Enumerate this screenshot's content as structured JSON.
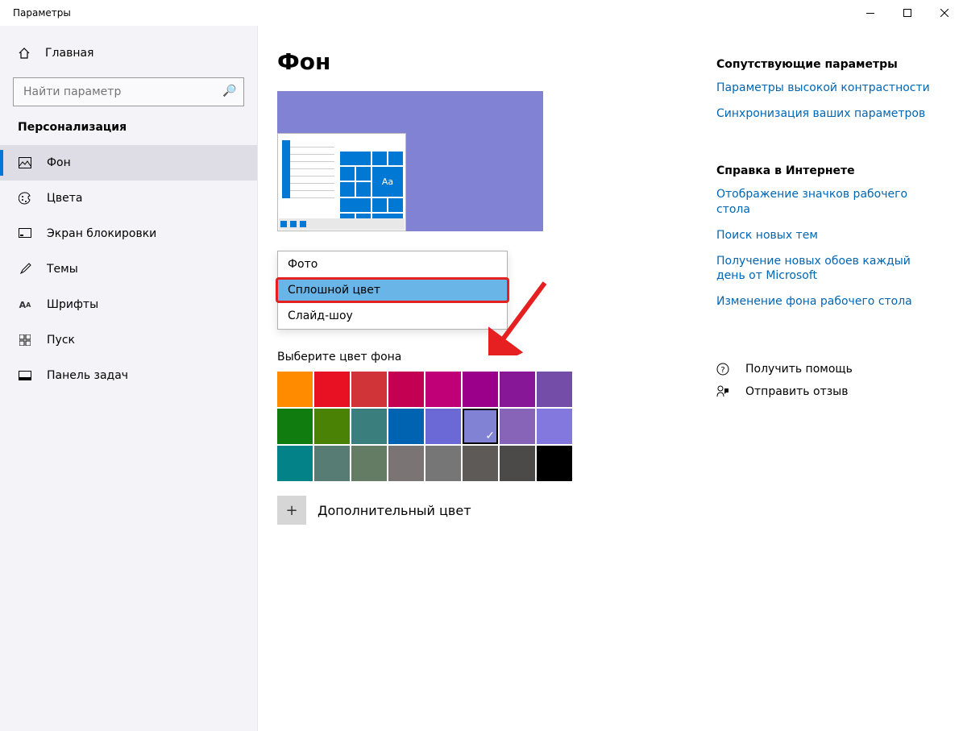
{
  "window": {
    "title": "Параметры"
  },
  "sidebar": {
    "home_label": "Главная",
    "search_placeholder": "Найти параметр",
    "section": "Персонализация",
    "items": [
      {
        "label": "Фон"
      },
      {
        "label": "Цвета"
      },
      {
        "label": "Экран блокировки"
      },
      {
        "label": "Темы"
      },
      {
        "label": "Шрифты"
      },
      {
        "label": "Пуск"
      },
      {
        "label": "Панель задач"
      }
    ]
  },
  "main": {
    "heading": "Фон",
    "preview_sample": "Aa",
    "dropdown": {
      "options": [
        {
          "label": "Фото"
        },
        {
          "label": "Сплошной цвет"
        },
        {
          "label": "Слайд-шоу"
        }
      ],
      "selected_index": 1
    },
    "swatch_label": "Выберите цвет фона",
    "swatches": [
      "#ff8c00",
      "#e81123",
      "#d13438",
      "#c30052",
      "#bf0077",
      "#9a0089",
      "#881798",
      "#744da9",
      "#107c10",
      "#498205",
      "#3a7e7e",
      "#0063b1",
      "#6b69d6",
      "#8182d4",
      "#8764b8",
      "#8378de",
      "#038387",
      "#567c73",
      "#647c64",
      "#7a7574",
      "#767676",
      "#5d5a58",
      "#4c4a48",
      "#000000"
    ],
    "selected_swatch_index": 13,
    "custom_color_label": "Дополнительный цвет"
  },
  "right": {
    "related_head": "Сопутствующие параметры",
    "related_links": [
      "Параметры высокой контрастности",
      "Синхронизация ваших параметров"
    ],
    "help_head": "Справка в Интернете",
    "help_links": [
      "Отображение значков рабочего стола",
      "Поиск новых тем",
      "Получение новых обоев каждый день от Microsoft",
      "Изменение фона рабочего стола"
    ],
    "get_help": "Получить помощь",
    "feedback": "Отправить отзыв"
  }
}
